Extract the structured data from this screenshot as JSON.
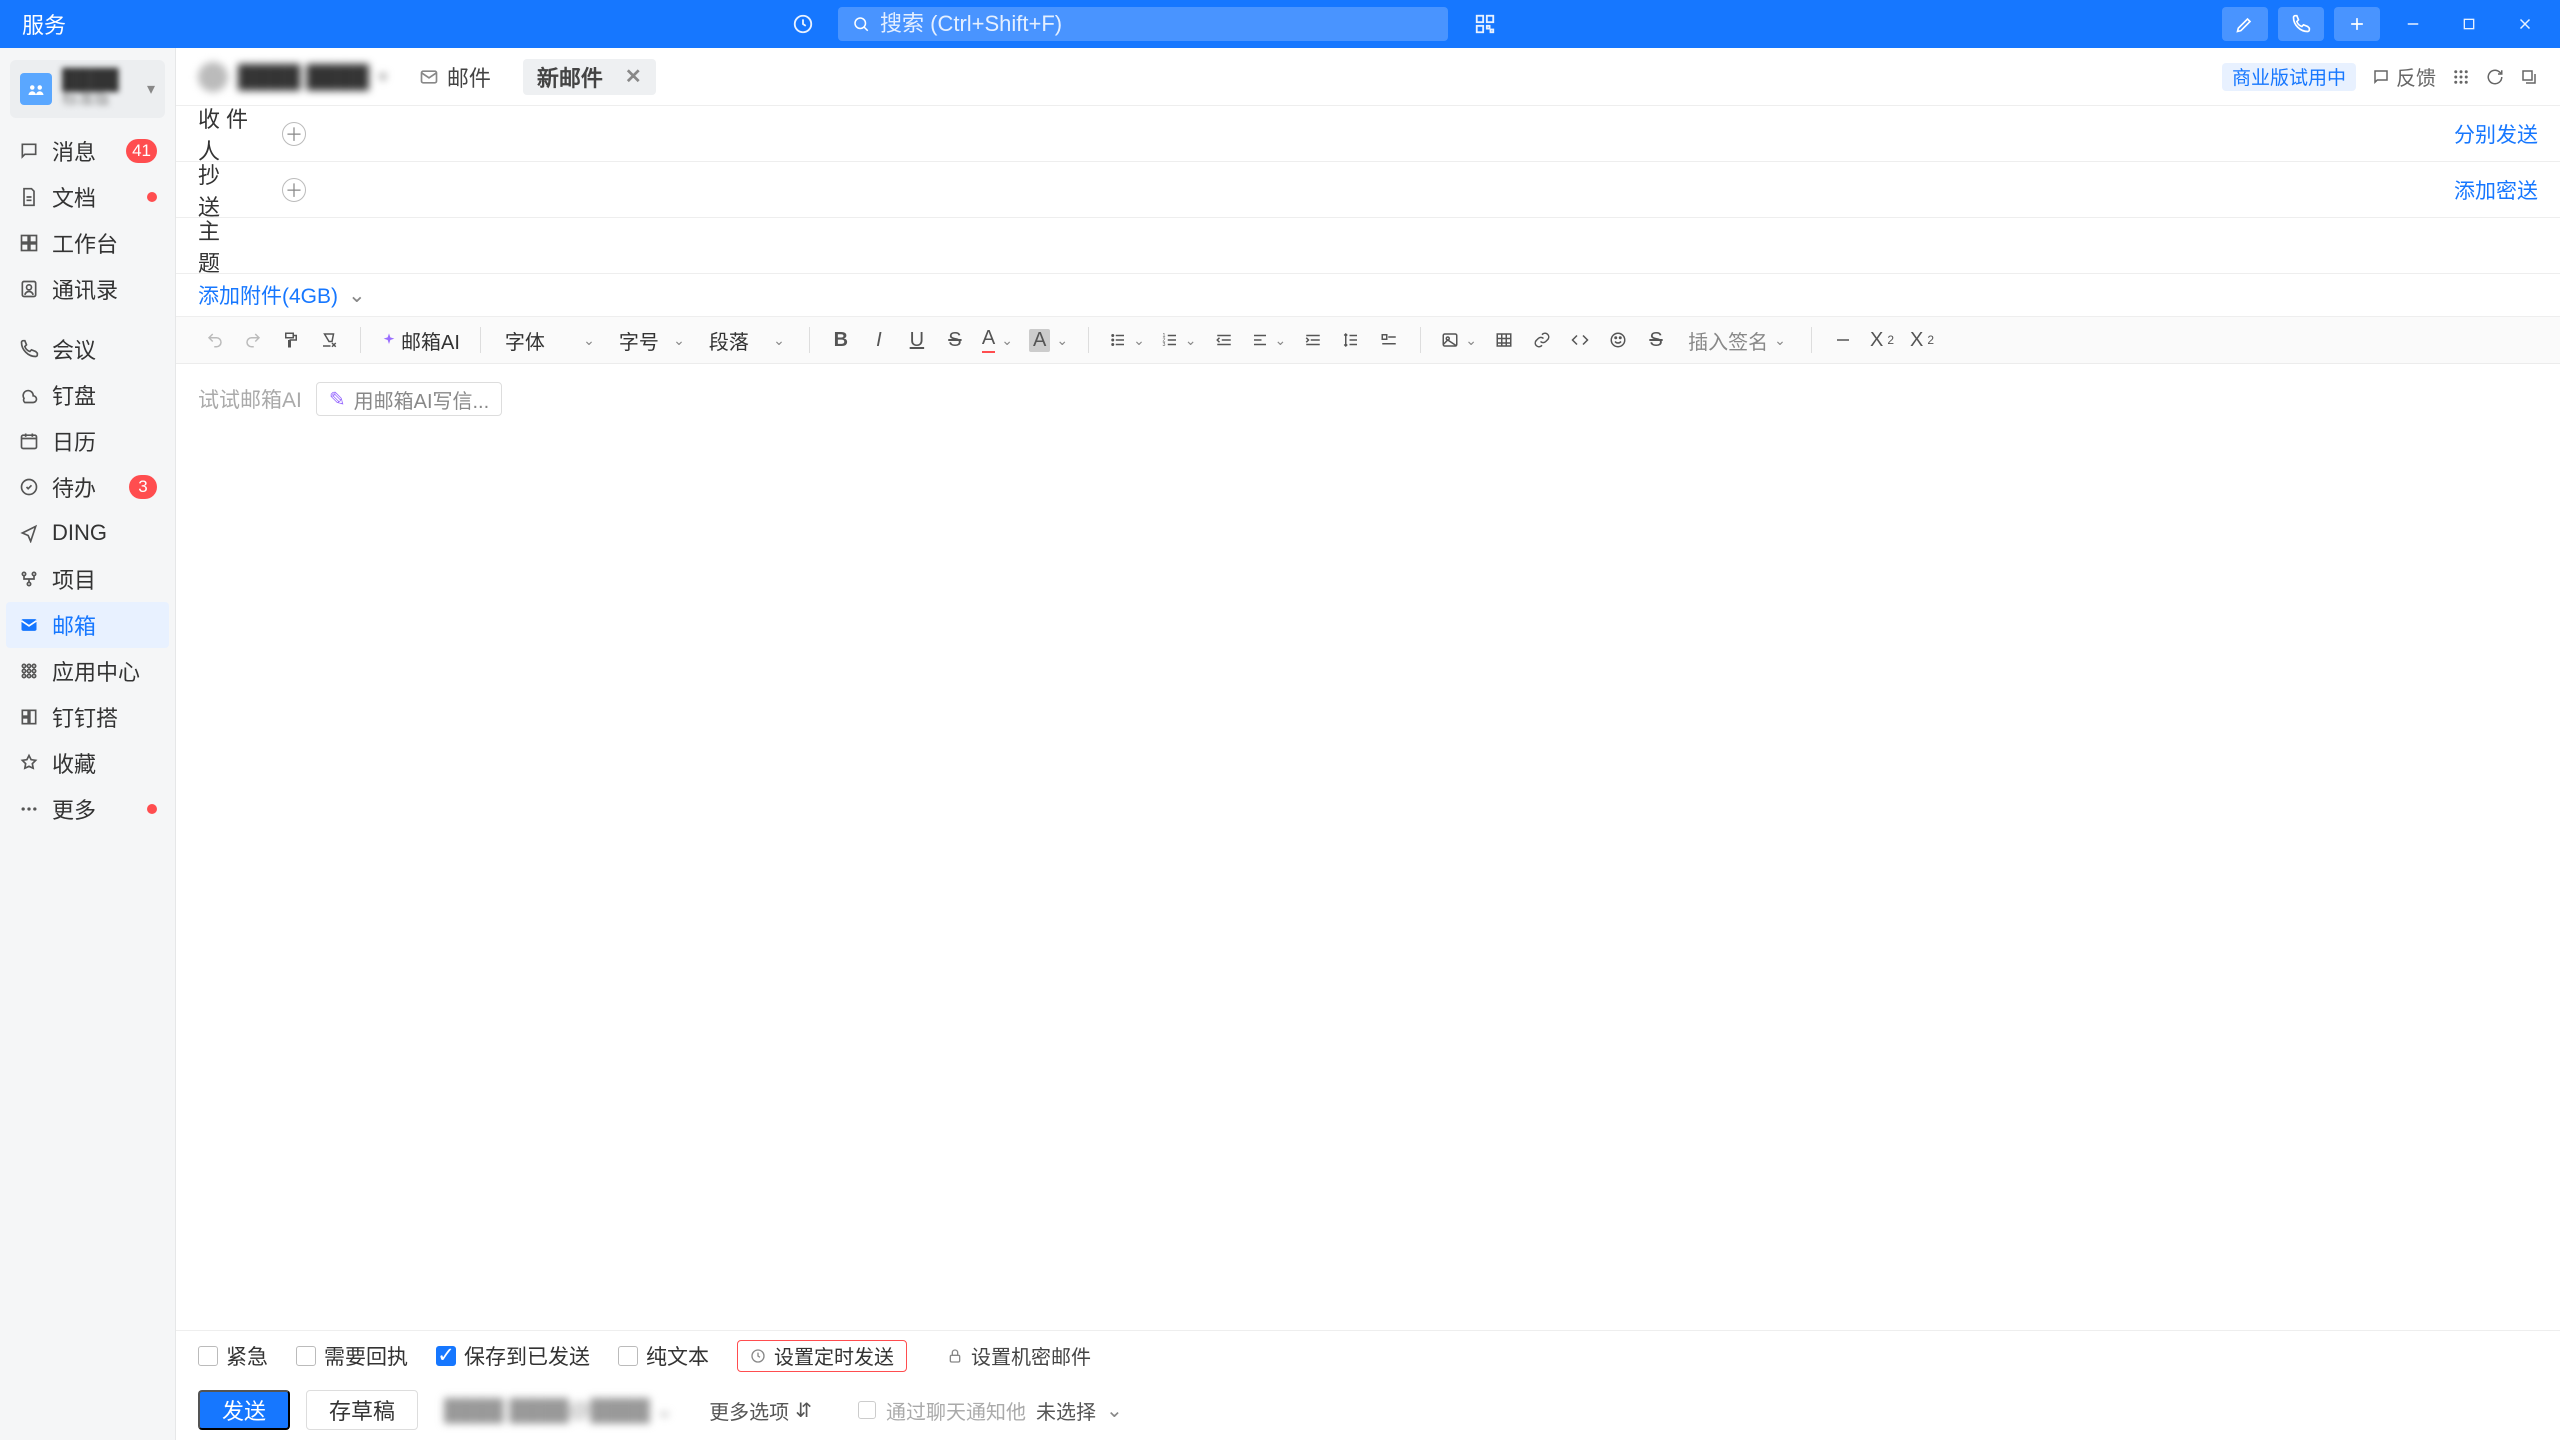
{
  "app": {
    "name": "服务"
  },
  "search": {
    "placeholder": "搜索 (Ctrl+Shift+F)"
  },
  "org": {
    "name": "████",
    "plan": "标准版"
  },
  "sidebar": {
    "items": [
      {
        "label": "消息",
        "icon": "chat-icon",
        "badge": "41"
      },
      {
        "label": "文档",
        "icon": "doc-icon",
        "dot": true
      },
      {
        "label": "工作台",
        "icon": "workbench-icon"
      },
      {
        "label": "通讯录",
        "icon": "contacts-icon"
      },
      {
        "label": "会议",
        "icon": "meeting-icon"
      },
      {
        "label": "钉盘",
        "icon": "drive-icon"
      },
      {
        "label": "日历",
        "icon": "calendar-icon"
      },
      {
        "label": "待办",
        "icon": "todo-icon",
        "badge": "3"
      },
      {
        "label": "DING",
        "icon": "ding-icon"
      },
      {
        "label": "项目",
        "icon": "project-icon"
      },
      {
        "label": "邮箱",
        "icon": "mail-icon",
        "active": true
      },
      {
        "label": "应用中心",
        "icon": "apps-icon"
      },
      {
        "label": "钉钉搭",
        "icon": "builder-icon"
      },
      {
        "label": "收藏",
        "icon": "favorite-icon"
      },
      {
        "label": "更多",
        "icon": "more-icon",
        "dot": true
      }
    ]
  },
  "user": {
    "name": "████ ████"
  },
  "tabs": {
    "inbox": {
      "label": "邮件"
    },
    "compose": {
      "label": "新邮件"
    }
  },
  "top_right": {
    "trial_pill": "商业版试用中",
    "feedback": "反馈"
  },
  "fields": {
    "to_label": "收件人",
    "cc_label": "抄 送",
    "subject_label": "主 题",
    "separate_send": "分别发送",
    "add_bcc": "添加密送"
  },
  "attach": {
    "label": "添加附件(4GB)"
  },
  "editor_toolbar": {
    "mail_ai": "邮箱AI",
    "font_family": "字体",
    "font_size": "字号",
    "paragraph": "段落",
    "insert_signature": "插入签名"
  },
  "editor": {
    "ai_hint_text": "试试邮箱AI",
    "ai_chip": "用邮箱AI写信..."
  },
  "options": {
    "urgent": "紧急",
    "need_receipt": "需要回执",
    "save_sent": "保存到已发送",
    "plain_text": "纯文本",
    "schedule": "设置定时发送",
    "confidential": "设置机密邮件"
  },
  "send_bar": {
    "send": "发送",
    "save_draft": "存草稿",
    "from_addr": "████ ████@████",
    "more_options": "更多选项",
    "chat_notify_label": "通过聊天通知他",
    "chat_notify_value": "未选择"
  }
}
